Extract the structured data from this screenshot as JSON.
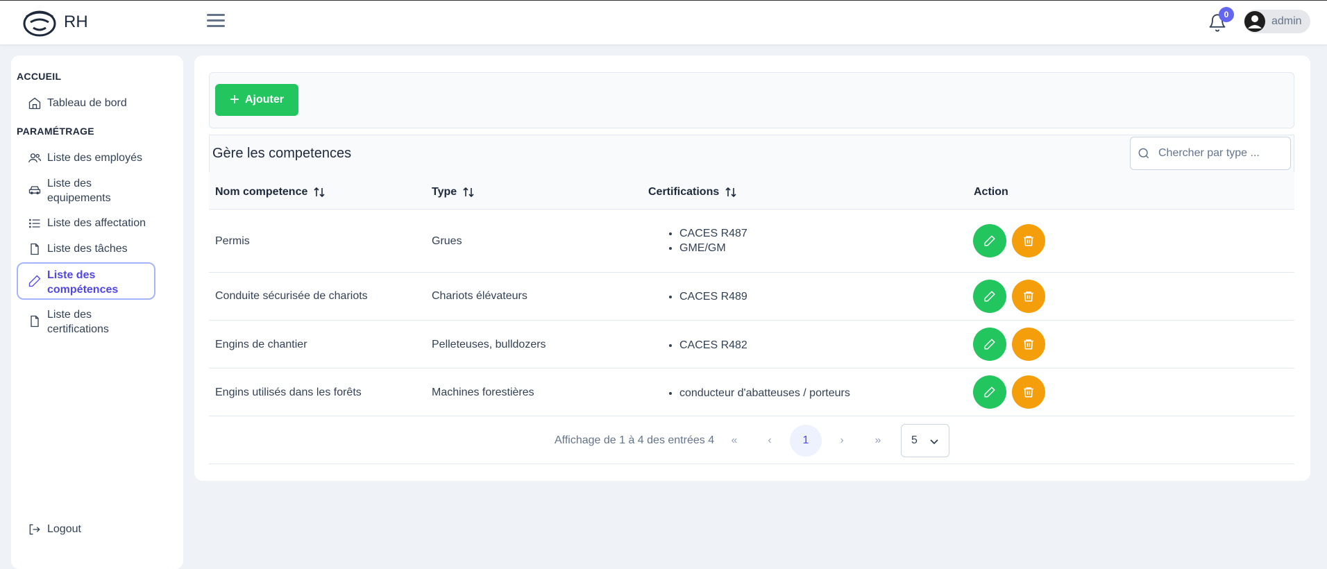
{
  "header": {
    "brand": "RH",
    "notifications_count": "0",
    "user_name": "admin"
  },
  "sidebar": {
    "section_home": "ACCUEIL",
    "dashboard": "Tableau de bord",
    "section_settings": "PARAMÉTRAGE",
    "items": [
      {
        "label": "Liste des employés",
        "icon": "users-icon"
      },
      {
        "label": "Liste des equipements",
        "icon": "car-icon"
      },
      {
        "label": "Liste des affectation",
        "icon": "list-icon"
      },
      {
        "label": "Liste des tâches",
        "icon": "file-icon"
      },
      {
        "label": "Liste des compétences",
        "icon": "pencil-icon",
        "active": true
      },
      {
        "label": "Liste des certifications",
        "icon": "file-icon"
      }
    ],
    "logout": "Logout"
  },
  "toolbar": {
    "add_label": "Ajouter"
  },
  "table": {
    "title": "Gère les competences",
    "search_placeholder": "Chercher par type ...",
    "columns": [
      "Nom competence",
      "Type",
      "Certifications",
      "Action"
    ],
    "rows": [
      {
        "name": "Permis",
        "type": "Grues",
        "certs": [
          "CACES R487",
          "GME/GM"
        ]
      },
      {
        "name": "Conduite sécurisée de chariots",
        "type": "Chariots élévateurs",
        "certs": [
          "CACES R489"
        ]
      },
      {
        "name": "Engins de chantier",
        "type": "Pelleteuses, bulldozers",
        "certs": [
          "CACES R482"
        ]
      },
      {
        "name": "Engins utilisés dans les forêts",
        "type": "Machines forestières",
        "certs": [
          "conducteur d'abatteuses / porteurs"
        ]
      }
    ]
  },
  "pagination": {
    "summary": "Affichage de 1 à 4 des entrées 4",
    "first": "«",
    "prev": "‹",
    "current_page": "1",
    "next": "›",
    "last": "»",
    "per_page": "5"
  },
  "colors": {
    "accent": "#6366f1",
    "success": "#22c55e",
    "warning": "#f59e0b"
  }
}
